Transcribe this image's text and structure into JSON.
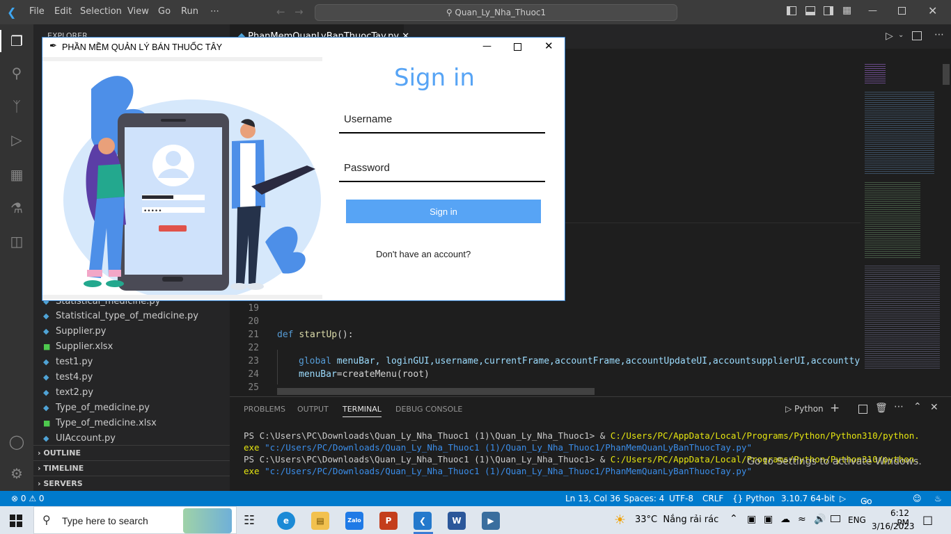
{
  "titlebar": {
    "menus": [
      "File",
      "Edit",
      "Selection",
      "View",
      "Go",
      "Run",
      "⋯"
    ],
    "command_center": "Quan_Ly_Nha_Thuoc1"
  },
  "sidebar": {
    "header": "EXPLORER",
    "files": [
      {
        "name": "Statistical_medicine.py",
        "type": "py"
      },
      {
        "name": "Statistical_type_of_medicine.py",
        "type": "py"
      },
      {
        "name": "Supplier.py",
        "type": "py"
      },
      {
        "name": "Supplier.xlsx",
        "type": "xlsx"
      },
      {
        "name": "test1.py",
        "type": "py"
      },
      {
        "name": "test4.py",
        "type": "py"
      },
      {
        "name": "text2.py",
        "type": "py"
      },
      {
        "name": "Type_of_medicine.py",
        "type": "py"
      },
      {
        "name": "Type_of_medicine.xlsx",
        "type": "xlsx"
      },
      {
        "name": "UIAccount.py",
        "type": "py"
      }
    ],
    "sections": [
      "OUTLINE",
      "TIMELINE",
      "SERVERS"
    ]
  },
  "editor": {
    "tab": "PhanMemQuanLyBanThuocTay.py",
    "line_numbers": [
      "19",
      "20",
      "21",
      "22",
      "23",
      "24",
      "25"
    ],
    "code": {
      "def_kw": "def",
      "def_name": "startUp",
      "def_rest": "():",
      "line23_kw": "global",
      "line23_rest": " menuBar, loginGUI,username,currentFrame,accountFrame,accountUpdateUI,accountsupplierUI,accounttype",
      "line24_var": "menuBar",
      "line24_rest": "=createMenu(root)"
    }
  },
  "panel": {
    "tabs": [
      "PROBLEMS",
      "OUTPUT",
      "TERMINAL",
      "DEBUG CONSOLE"
    ],
    "active_tab": "TERMINAL",
    "shell": "Python",
    "terminal": {
      "prompt": "PS C:\\Users\\PC\\Downloads\\Quan_Ly_Nha_Thuoc1 (1)\\Quan_Ly_Nha_Thuoc1> & ",
      "exe_path": "C:/Users/PC/AppData/Local/Programs/Python/Python310/python.",
      "exe_cont": "exe",
      "script_path": " \"c:/Users/PC/Downloads/Quan_Ly_Nha_Thuoc1 (1)/Quan_Ly_Nha_Thuoc1/PhanMemQuanLyBanThuocTay.py\""
    },
    "watermark": "Go to Settings to activate Windows."
  },
  "statusbar": {
    "problems": "⊗ 0 ⚠ 0",
    "position": "Ln 13, Col 36",
    "spaces": "Spaces: 4",
    "encoding": "UTF-8",
    "eol": "CRLF",
    "language": "{} Python",
    "interpreter": "3.10.7 64-bit",
    "golive": "Go Live"
  },
  "app": {
    "window_title": "PHẦN MỀM QUẢN LÝ BÁN THUỐC TÂY",
    "signin_title": "Sign in",
    "username_placeholder": "Username",
    "password_placeholder": "Password",
    "signin_button": "Sign in",
    "no_account": "Don't have an account?",
    "accent": "#57a4f5"
  },
  "taskbar": {
    "search_placeholder": "Type here to search",
    "weather": "33°C  Nắng rải rác",
    "lang": "ENG",
    "time": "6:12 PM",
    "date": "3/16/2023"
  }
}
